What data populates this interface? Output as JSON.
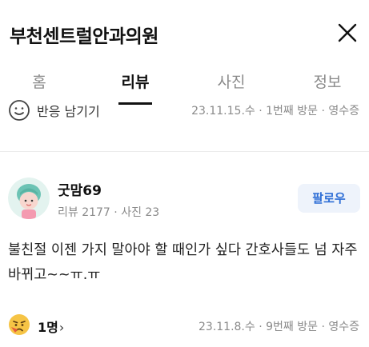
{
  "header": {
    "title": "부천센트럴안과의원",
    "close_icon": "close-icon"
  },
  "tabs": [
    {
      "label": "홈",
      "active": false
    },
    {
      "label": "리뷰",
      "active": true
    },
    {
      "label": "사진",
      "active": false
    },
    {
      "label": "정보",
      "active": false
    }
  ],
  "previous_review": {
    "react_label": "반응 남기기",
    "meta": "23.11.15.수 · 1번째 방문 · 영수증"
  },
  "review": {
    "user_name": "굿맘69",
    "user_stats": "리뷰 2177 · 사진 23",
    "follow_label": "팔로우",
    "text": "불친절 이젠 가지 말아야 할 때인가 싶다 간호사들도 넘 자주바뀌고~~ㅠ.ㅠ",
    "reaction_count": "1명",
    "reaction_chevron": "›",
    "meta": "23.11.8.수 · 9번째 방문 · 영수증"
  },
  "colors": {
    "accent": "#2f6fd6",
    "follow_bg": "#eef3fb",
    "muted_text": "#8a8a8a",
    "divider": "#ececec"
  }
}
